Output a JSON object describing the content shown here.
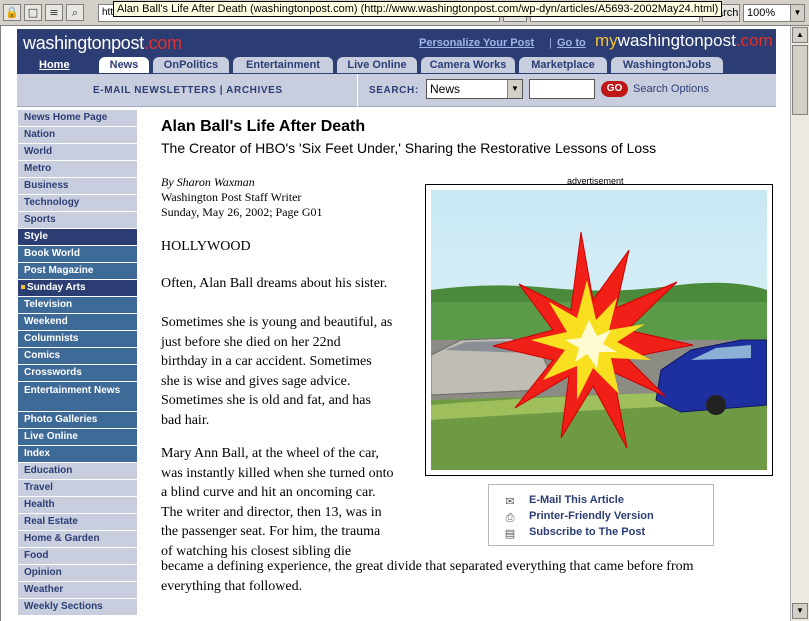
{
  "browser": {
    "address_text": "http://www.washingtonpost.com/wp-dyn/articles/A5693-2002May24.html",
    "tooltip": "Alan Ball's Life After Death (washingtonpost.com) (http://www.washingtonpost.com/wp-dyn/articles/A5693-2002May24.html)",
    "search_label": "Search",
    "zoom": "100%"
  },
  "masthead": {
    "logo_main": "washingtonpost",
    "logo_dotcom": ".com",
    "personalize": "Personalize Your Post",
    "separator": "|",
    "goto": "Go to",
    "my": "my",
    "mywp_main": "washingtonpost",
    "mywp_dotcom": ".com",
    "home": "Home",
    "tabs": [
      "News",
      "OnPolitics",
      "Entertainment",
      "Live Online",
      "Camera Works",
      "Marketplace",
      "WashingtonJobs"
    ]
  },
  "subbar": {
    "newsletters": "E-MAIL NEWSLETTERS | ARCHIVES",
    "search_label": "SEARCH:",
    "selected_site": "News",
    "go": "GO",
    "search_options": "Search Options"
  },
  "nav": [
    {
      "label": "News Home Page",
      "style": "light"
    },
    {
      "label": "Nation",
      "style": "light"
    },
    {
      "label": "World",
      "style": "light"
    },
    {
      "label": "Metro",
      "style": "light"
    },
    {
      "label": "Business",
      "style": "light"
    },
    {
      "label": "Technology",
      "style": "light"
    },
    {
      "label": "Sports",
      "style": "light"
    },
    {
      "label": "Style",
      "style": "black"
    },
    {
      "label": "Book World",
      "style": "dark"
    },
    {
      "label": "Post Magazine",
      "style": "dark"
    },
    {
      "label": "Sunday Arts",
      "style": "black"
    },
    {
      "label": "Television",
      "style": "dark"
    },
    {
      "label": "Weekend",
      "style": "dark"
    },
    {
      "label": "Columnists",
      "style": "dark"
    },
    {
      "label": "Comics",
      "style": "dark"
    },
    {
      "label": "Crosswords",
      "style": "dark"
    },
    {
      "label": "Entertainment News",
      "style": "dark"
    },
    {
      "label": "Photo Galleries",
      "style": "dark"
    },
    {
      "label": "Live Online",
      "style": "dark"
    },
    {
      "label": "Index",
      "style": "dark"
    },
    {
      "label": "Education",
      "style": "light"
    },
    {
      "label": "Travel",
      "style": "light"
    },
    {
      "label": "Health",
      "style": "light"
    },
    {
      "label": "Real Estate",
      "style": "light"
    },
    {
      "label": "Home & Garden",
      "style": "light"
    },
    {
      "label": "Food",
      "style": "light"
    },
    {
      "label": "Opinion",
      "style": "light"
    },
    {
      "label": "Weather",
      "style": "light"
    },
    {
      "label": "Weekly Sections",
      "style": "light"
    }
  ],
  "article": {
    "headline": "Alan Ball's Life After Death",
    "subhead": "The Creator of HBO's 'Six Feet Under,' Sharing the Restorative Lessons of Loss",
    "byline": "By Sharon Waxman",
    "role": "Washington Post Staff Writer",
    "dateline": "Sunday, May 26, 2002; Page G01",
    "p0": "HOLLYWOOD",
    "p1": "Often, Alan Ball dreams about his sister.",
    "p2": [
      "Sometimes she is young and beautiful, as",
      "just before she died on her 22nd",
      "birthday in a car accident. Sometimes",
      "she is wise and gives sage advice.",
      "Sometimes she is old and fat, and has",
      "bad hair."
    ],
    "p3": [
      "Mary Ann Ball, at the wheel of the car,",
      "was instantly killed when she turned onto",
      "a blind curve and hit an oncoming car.",
      "The writer and director, then 13, was in",
      "the passenger seat. For him, the trauma",
      "of watching his closest sibling die"
    ],
    "p3_end": [
      "became a defining experience, the great divide that separated everything that came before from",
      "everything that followed."
    ]
  },
  "ad": {
    "label": "advertisement"
  },
  "tools": {
    "email": "E-Mail This Article",
    "print": "Printer-Friendly Version",
    "subscribe": "Subscribe to The Post"
  },
  "icons": [
    "lock-icon",
    "window-icon",
    "page-icon",
    "search-icon",
    "envelope-icon",
    "printer-icon",
    "newspaper-icon"
  ]
}
